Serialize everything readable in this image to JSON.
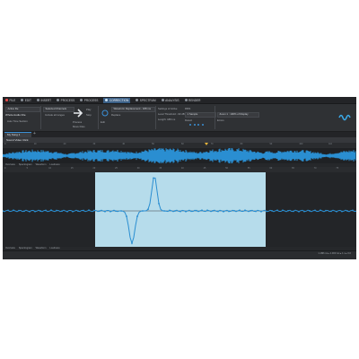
{
  "menu": [
    {
      "id": "file",
      "label": "FILE"
    },
    {
      "id": "edit",
      "label": "EDIT"
    },
    {
      "id": "insert",
      "label": "INSERT"
    },
    {
      "id": "process",
      "label": "PROCESS"
    },
    {
      "id": "correction",
      "label": "CORRECTION"
    },
    {
      "id": "spectrum",
      "label": "SPECTRUM"
    },
    {
      "id": "analysis",
      "label": "ANALYSIS"
    },
    {
      "id": "render",
      "label": "RENDER"
    }
  ],
  "ribbon": {
    "preset_field": "Active file",
    "preset_name": "Whole Audio File",
    "check_label": "Auto Time Section",
    "selection_field": "Selected Channels",
    "radio_label": "Include all ranges",
    "process_btn_label": "Process",
    "after_label": "Move Files",
    "playback_label": "Play",
    "stop_label": "Stop",
    "correction_field": "Waveform Replacement - 188 ms",
    "edit_label": "Edit",
    "replace_label": "Replace",
    "settings_field": "Settings of Active",
    "level_label": "Level Threshold: -90 dB",
    "length_label": "Length: 188 ms",
    "rms_label": "RMS",
    "detect_label": "Detect",
    "channel_field": "1 Sample",
    "zoom_field": "Zoom 1 : 100% of Display",
    "errors_label": "Errors"
  },
  "tabs": {
    "doc_tab_label": "My Song 1",
    "add_tab": "+"
  },
  "track": {
    "name": "Sound Video Click"
  },
  "overview_ruler": [
    "0",
    "10",
    "20",
    "30",
    "40",
    "50",
    "60",
    "70",
    "80",
    "90",
    "100",
    "110"
  ],
  "main_ruler": [
    "0",
    "5",
    "10",
    "15",
    "20",
    "25",
    "30",
    "35",
    "40",
    "45",
    "50",
    "55",
    "60",
    "65",
    "70",
    "75"
  ],
  "status_top": [
    "Overview",
    "Spectrogram",
    "Waveform",
    "Loudness"
  ],
  "status_bottom": [
    "Overview",
    "Spectrogram",
    "Waveform",
    "Loudness"
  ],
  "footer": {
    "selection": "1.188 ms  ▸  1.000 ms  ▸  1 s  ▸  0.0"
  },
  "colors": {
    "wave": "#2a8ed1",
    "selection_bg": "#b6dceb",
    "bg": "#2b2d30",
    "accent": "#3a8fd6"
  },
  "icons": [
    "waveform-logo-icon",
    "arrow-right-icon",
    "play-icon",
    "stop-icon",
    "dot-icon"
  ]
}
